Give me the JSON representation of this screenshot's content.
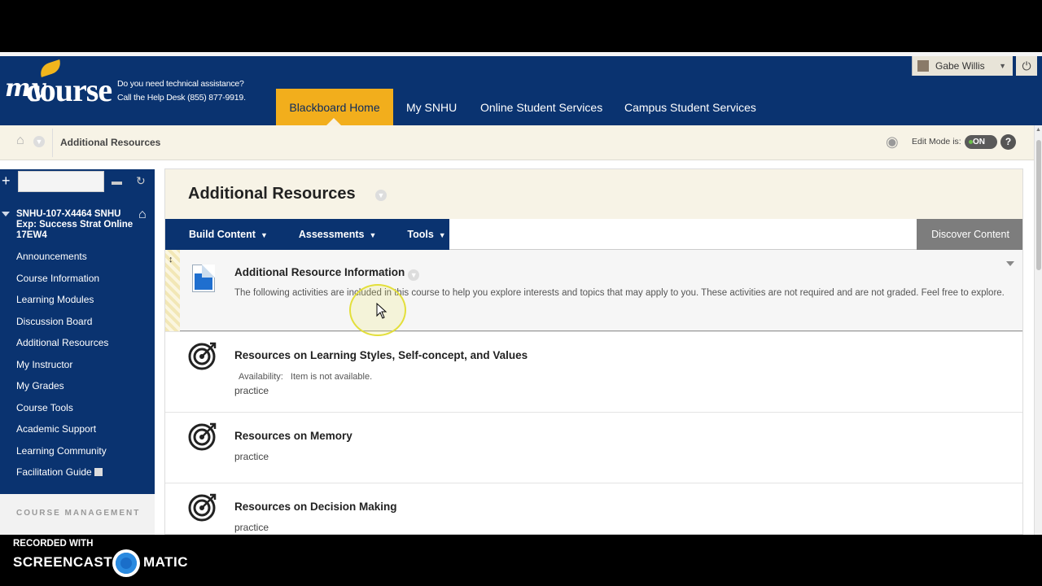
{
  "header": {
    "logo_text_my": "my",
    "logo_text_course": "course",
    "help_line1": "Do you need technical assistance?",
    "help_line2": "Call the Help Desk (855) 877-9919.",
    "nav": [
      "Blackboard Home",
      "My SNHU",
      "Online Student Services",
      "Campus Student Services"
    ],
    "user_name": "Gabe Willis"
  },
  "breadcrumb": {
    "current": "Additional Resources",
    "edit_mode_label": "Edit Mode is:",
    "edit_mode_value": "ON",
    "help": "?"
  },
  "sidebar": {
    "course_name": "SNHU-107-X4464 SNHU Exp: Success Strat Online 17EW4",
    "items": [
      "Announcements",
      "Course Information",
      "Learning Modules",
      "Discussion Board",
      "Additional Resources",
      "My Instructor",
      "My Grades",
      "Course Tools",
      "Academic Support",
      "Learning Community",
      "Facilitation Guide"
    ],
    "section_label": "COURSE MANAGEMENT"
  },
  "content": {
    "title": "Additional Resources",
    "toolbar": [
      "Build Content",
      "Assessments",
      "Tools"
    ],
    "discover": "Discover Content",
    "items": [
      {
        "title": "Additional Resource Information",
        "description": "The following activities are included in this course to help you explore interests and topics that may apply to you. These activities are not required and are not graded. Feel free to explore."
      },
      {
        "title": "Resources on Learning Styles, Self-concept, and Values",
        "availability_label": "Availability:",
        "availability_value": "Item is not available.",
        "note": "practice"
      },
      {
        "title": "Resources on Memory",
        "note": "practice"
      },
      {
        "title": "Resources on Decision Making",
        "note": "practice"
      }
    ]
  },
  "recorder": {
    "line1": "RECORDED WITH",
    "brand_left": "SCREENCAST",
    "brand_right": "MATIC"
  },
  "colors": {
    "header_blue": "#0a3370",
    "accent_gold": "#f2ae1c",
    "panel_beige": "#f7f3e6"
  },
  "icons": [
    "home-icon",
    "eye-icon",
    "power-icon",
    "target-icon",
    "document-icon",
    "refresh-icon"
  ]
}
